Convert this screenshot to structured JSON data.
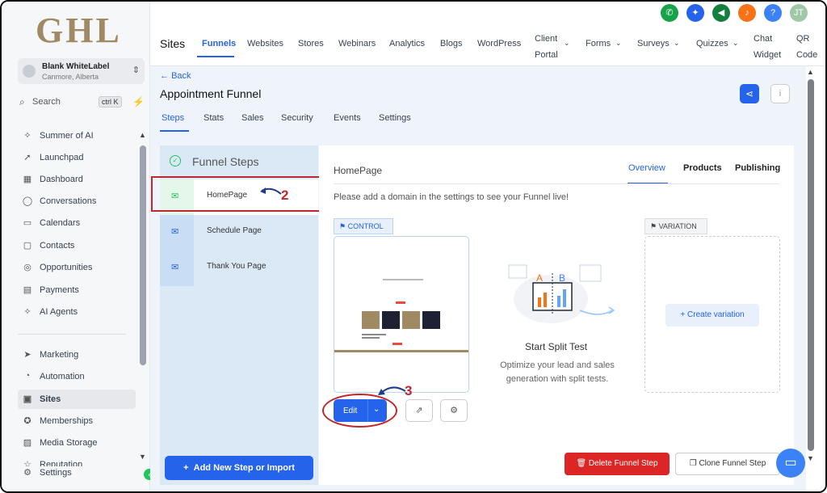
{
  "brand": {
    "logo": "GHL"
  },
  "account": {
    "name": "Blank WhiteLabel",
    "location": "Canmore, Alberta"
  },
  "search": {
    "placeholder": "Search",
    "shortcut": "ctrl K"
  },
  "sidebar": {
    "items": [
      {
        "label": "Summer of AI",
        "icon": "sparkle-icon"
      },
      {
        "label": "Launchpad",
        "icon": "rocket-icon"
      },
      {
        "label": "Dashboard",
        "icon": "grid-icon"
      },
      {
        "label": "Conversations",
        "icon": "chat-icon"
      },
      {
        "label": "Calendars",
        "icon": "calendar-icon"
      },
      {
        "label": "Contacts",
        "icon": "contacts-icon"
      },
      {
        "label": "Opportunities",
        "icon": "target-icon"
      },
      {
        "label": "Payments",
        "icon": "receipt-icon"
      },
      {
        "label": "AI Agents",
        "icon": "sparkle-icon"
      },
      {
        "label": "Marketing",
        "icon": "send-icon"
      },
      {
        "label": "Automation",
        "icon": "gauge-icon"
      },
      {
        "label": "Sites",
        "icon": "sites-icon"
      },
      {
        "label": "Memberships",
        "icon": "badge-icon"
      },
      {
        "label": "Media Storage",
        "icon": "image-icon"
      },
      {
        "label": "Reputation",
        "icon": "star-icon"
      }
    ],
    "settings_label": "Settings",
    "active": "Sites"
  },
  "topnav": {
    "section": "Sites",
    "tabs": [
      "Funnels",
      "Websites",
      "Stores",
      "Webinars",
      "Analytics",
      "Blogs",
      "WordPress",
      "Client Portal",
      "Forms",
      "Surveys",
      "Quizzes",
      "Chat Widget",
      "QR Code"
    ],
    "active": "Funnels"
  },
  "header_icons": [
    {
      "name": "phone-icon",
      "color": "#16a34a"
    },
    {
      "name": "magic-wand-icon",
      "color": "#2563eb"
    },
    {
      "name": "megaphone-icon",
      "color": "#15803d"
    },
    {
      "name": "bell-icon",
      "color": "#f97316"
    },
    {
      "name": "help-icon",
      "color": "#3b82f6"
    }
  ],
  "user": {
    "initials": "JT"
  },
  "page": {
    "back_label": "Back",
    "title": "Appointment Funnel"
  },
  "funnel_tabs": [
    "Steps",
    "Stats",
    "Sales",
    "Security",
    "Events",
    "Settings"
  ],
  "funnel_tab_active": "Steps",
  "funnel_steps": {
    "title": "Funnel Steps",
    "steps": [
      "HomePage",
      "Schedule Page",
      "Thank You Page"
    ],
    "selected": "HomePage",
    "add_button": "Add New Step or Import"
  },
  "step_detail": {
    "name": "HomePage",
    "tabs": [
      "Overview",
      "Products",
      "Publishing"
    ],
    "active_tab": "Overview",
    "notice": "Please add a domain in the settings to see your Funnel live!",
    "control_label": "CONTROL",
    "variation_label": "VARIATION",
    "create_variation": "Create variation",
    "split_title": "Start Split Test",
    "split_desc": "Optimize your lead and sales generation with split tests.",
    "edit_label": "Edit",
    "delete_label": "Delete Funnel Step",
    "clone_label": "Clone Funnel Step"
  },
  "annotations": {
    "step_marker": "2",
    "edit_marker": "3"
  },
  "colors": {
    "accent": "#2563eb",
    "danger": "#dc2626",
    "annotation": "#c0272d"
  }
}
